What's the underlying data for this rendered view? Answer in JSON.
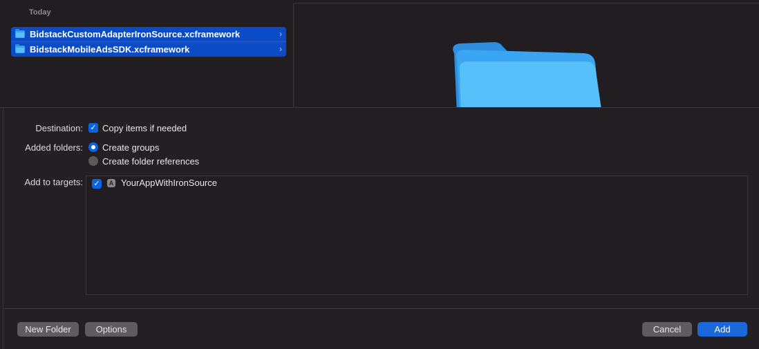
{
  "browser": {
    "section_header": "Today",
    "files": [
      {
        "name": "BidstackCustomAdapterIronSource.xcframework",
        "icon": "folder-icon"
      },
      {
        "name": "BidstackMobileAdsSDK.xcframework",
        "icon": "folder-icon"
      }
    ],
    "preview_icon": "folder-icon"
  },
  "options": {
    "destination": {
      "label": "Destination:",
      "checkbox_label": "Copy items if needed",
      "checked": true
    },
    "added_folders": {
      "label": "Added folders:",
      "choices": [
        {
          "label": "Create groups",
          "selected": true
        },
        {
          "label": "Create folder references",
          "selected": false
        }
      ]
    },
    "targets": {
      "label": "Add to targets:",
      "items": [
        {
          "name": "YourAppWithIronSource",
          "checked": true,
          "icon": "app-target-icon"
        }
      ]
    }
  },
  "footer": {
    "new_folder": "New Folder",
    "options": "Options",
    "cancel": "Cancel",
    "add": "Add"
  },
  "colors": {
    "background": "#231f23",
    "selection": "#0b4bc6",
    "accent": "#1a68d9",
    "folder_blue": "#5bc2fb"
  }
}
